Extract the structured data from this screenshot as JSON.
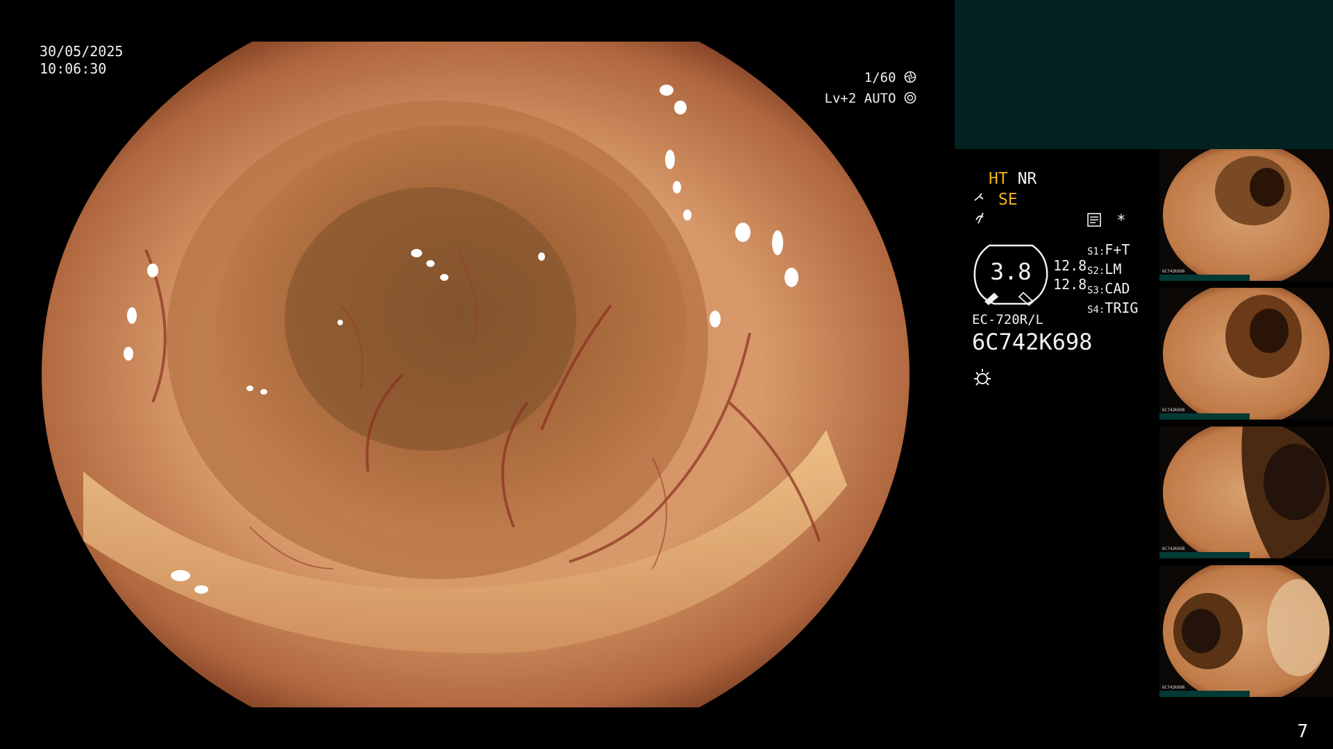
{
  "overlay": {
    "date": "30/05/2025",
    "time": "10:06:30",
    "shutter": "1/60",
    "level": "Lv+2",
    "mode": "AUTO",
    "frame_number": "7"
  },
  "settings": {
    "ht": "HT",
    "nr": "NR",
    "se": "SE",
    "zoom_value": "3.8",
    "value_1": "12.8",
    "value_2": "12.8",
    "s1_key": "S1",
    "s1_value": "F+T",
    "s2_key": "S2",
    "s2_value": "LM",
    "s3_key": "S3",
    "s3_value": "CAD",
    "s4_key": "S4",
    "s4_value": "TRIG",
    "asterisk": "*",
    "scope_model": "EC-720R/L",
    "serial": "6C742K698"
  },
  "icons": {
    "shutter": "aperture-icon",
    "auto": "iris-icon",
    "se": "scope-tip-icon",
    "signal": "signal-icon",
    "memo": "memo-icon",
    "light": "light-icon"
  },
  "colors": {
    "accent_yellow": "#f3b21a",
    "panel_teal": "#022221",
    "bar_teal": "#033a35"
  },
  "thumbnails": [
    {
      "label": "6C742K698"
    },
    {
      "label": "6C742K698"
    },
    {
      "label": "6C742K698"
    },
    {
      "label": "6C742K698"
    }
  ]
}
